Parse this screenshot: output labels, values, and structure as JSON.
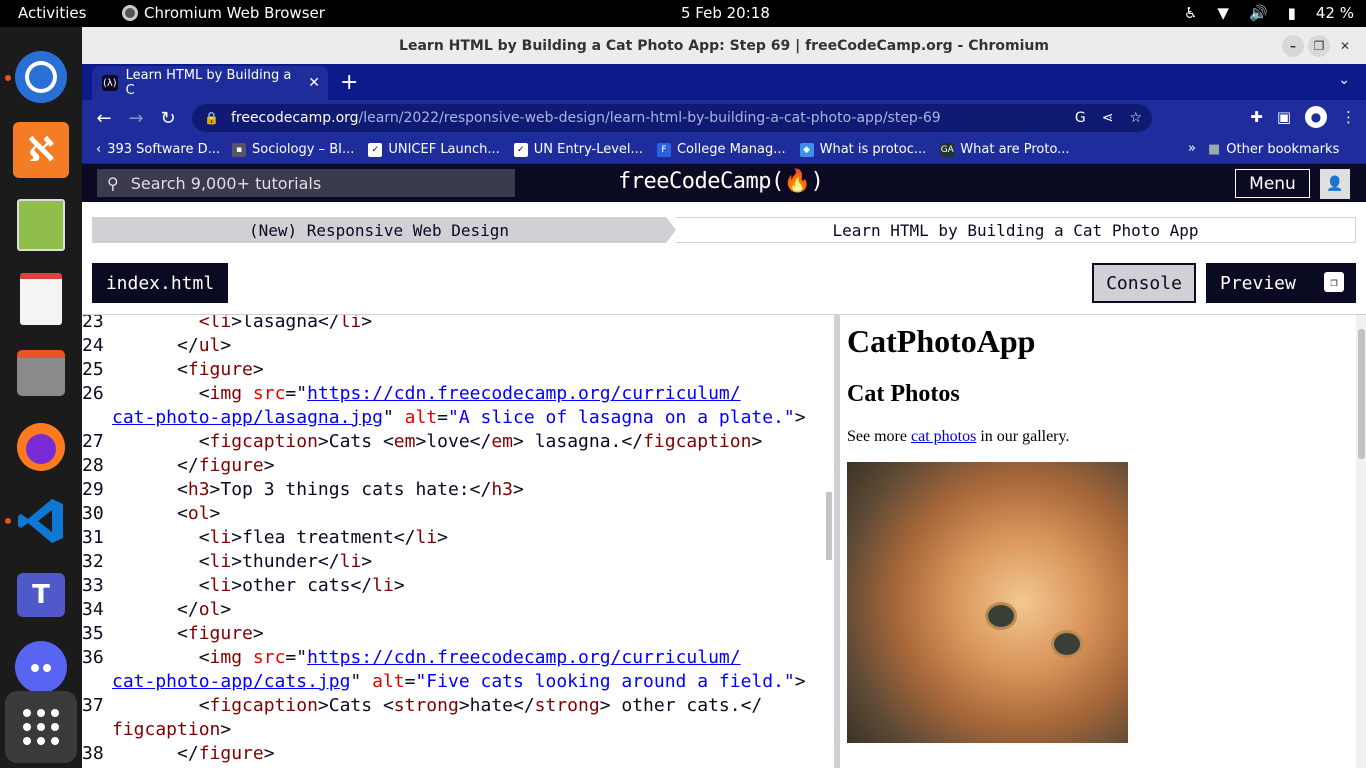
{
  "system": {
    "activities": "Activities",
    "active_app": "Chromium Web Browser",
    "clock": "5 Feb  20:18",
    "battery": "42 %"
  },
  "dock": {
    "items": [
      "chromium-icon",
      "xampp-icon",
      "text-editor-icon",
      "document-viewer-icon",
      "files-icon",
      "firefox-icon",
      "vscode-icon",
      "teams-icon",
      "discord-icon",
      "app-grid-icon"
    ]
  },
  "window": {
    "title": "Learn HTML by Building a Cat Photo App: Step 69 | freeCodeCamp.org - Chromium"
  },
  "browser": {
    "tab_title": "Learn HTML by Building a C",
    "url_host": "freecodecamp.org",
    "url_path": "/learn/2022/responsive-web-design/learn-html-by-building-a-cat-photo-app/step-69",
    "bookmarks": [
      "393 Software D...",
      "Sociology – BI...",
      "UNICEF Launch...",
      "UN Entry-Level...",
      "College Manag...",
      "What is protoc...",
      "What are Proto..."
    ],
    "other_bookmarks": "Other bookmarks"
  },
  "fcc": {
    "search_placeholder": "Search 9,000+ tutorials",
    "logo": "freeCodeCamp(🔥)",
    "menu": "Menu",
    "breadcrumb_left": "(New) Responsive Web Design",
    "breadcrumb_right": "Learn HTML by Building a Cat Photo App",
    "file_tab": "index.html",
    "console": "Console",
    "preview": "Preview"
  },
  "code_lines": [
    {
      "n": "23",
      "html": "        <span class=\"tag\">&lt;li</span>&gt;lasagna&lt;/<span class=\"tag\">li</span>&gt;"
    },
    {
      "n": "24",
      "html": "      &lt;/<span class=\"tag\">ul</span>&gt;"
    },
    {
      "n": "25",
      "html": "      &lt;<span class=\"tag\">figure</span>&gt;"
    },
    {
      "n": "26",
      "html": "        &lt;<span class=\"tag\">img</span> <span class=\"attr\">src</span>=\"<span class=\"url\">https://cdn.freecodecamp.org/curriculum/</span>"
    },
    {
      "n": "",
      "html": "<span class=\"url\">cat-photo-app/lasagna.jpg</span>\" <span class=\"attr\">alt</span>=<span class=\"val\">\"A slice of lasagna on a plate.\"</span>&gt;"
    },
    {
      "n": "27",
      "html": "        &lt;<span class=\"tag\">figcaption</span>&gt;Cats &lt;<span class=\"tag\">em</span>&gt;love&lt;/<span class=\"tag\">em</span>&gt; lasagna.&lt;/<span class=\"tag\">figcaption</span>&gt;"
    },
    {
      "n": "28",
      "html": "      &lt;/<span class=\"tag\">figure</span>&gt;"
    },
    {
      "n": "29",
      "html": "      &lt;<span class=\"tag\">h3</span>&gt;Top 3 things cats hate:&lt;/<span class=\"tag\">h3</span>&gt;"
    },
    {
      "n": "30",
      "html": "      &lt;<span class=\"tag\">ol</span>&gt;"
    },
    {
      "n": "31",
      "html": "        &lt;<span class=\"tag\">li</span>&gt;flea treatment&lt;/<span class=\"tag\">li</span>&gt;"
    },
    {
      "n": "32",
      "html": "        &lt;<span class=\"tag\">li</span>&gt;thunder&lt;/<span class=\"tag\">li</span>&gt;"
    },
    {
      "n": "33",
      "html": "        &lt;<span class=\"tag\">li</span>&gt;other cats&lt;/<span class=\"tag\">li</span>&gt;"
    },
    {
      "n": "34",
      "html": "      &lt;/<span class=\"tag\">ol</span>&gt;"
    },
    {
      "n": "35",
      "html": "      &lt;<span class=\"tag\">figure</span>&gt;"
    },
    {
      "n": "36",
      "html": "        &lt;<span class=\"tag\">img</span> <span class=\"attr\">src</span>=\"<span class=\"url\">https://cdn.freecodecamp.org/curriculum/</span>"
    },
    {
      "n": "",
      "html": "<span class=\"url\">cat-photo-app/cats.jpg</span>\" <span class=\"attr\">alt</span>=<span class=\"val\">\"Five cats looking around a field.\"</span>&gt;"
    },
    {
      "n": "37",
      "html": "        &lt;<span class=\"tag\">figcaption</span>&gt;Cats &lt;<span class=\"tag\">strong</span>&gt;hate&lt;/<span class=\"tag\">strong</span>&gt; other cats.&lt;/"
    },
    {
      "n": "",
      "html": "<span class=\"tag\">figcaption</span>&gt;"
    },
    {
      "n": "38",
      "html": "      &lt;/<span class=\"tag\">figure</span>&gt;"
    }
  ],
  "preview": {
    "h1": "CatPhotoApp",
    "h2": "Cat Photos",
    "p_before": "See more ",
    "p_link": "cat photos",
    "p_after": " in our gallery."
  }
}
